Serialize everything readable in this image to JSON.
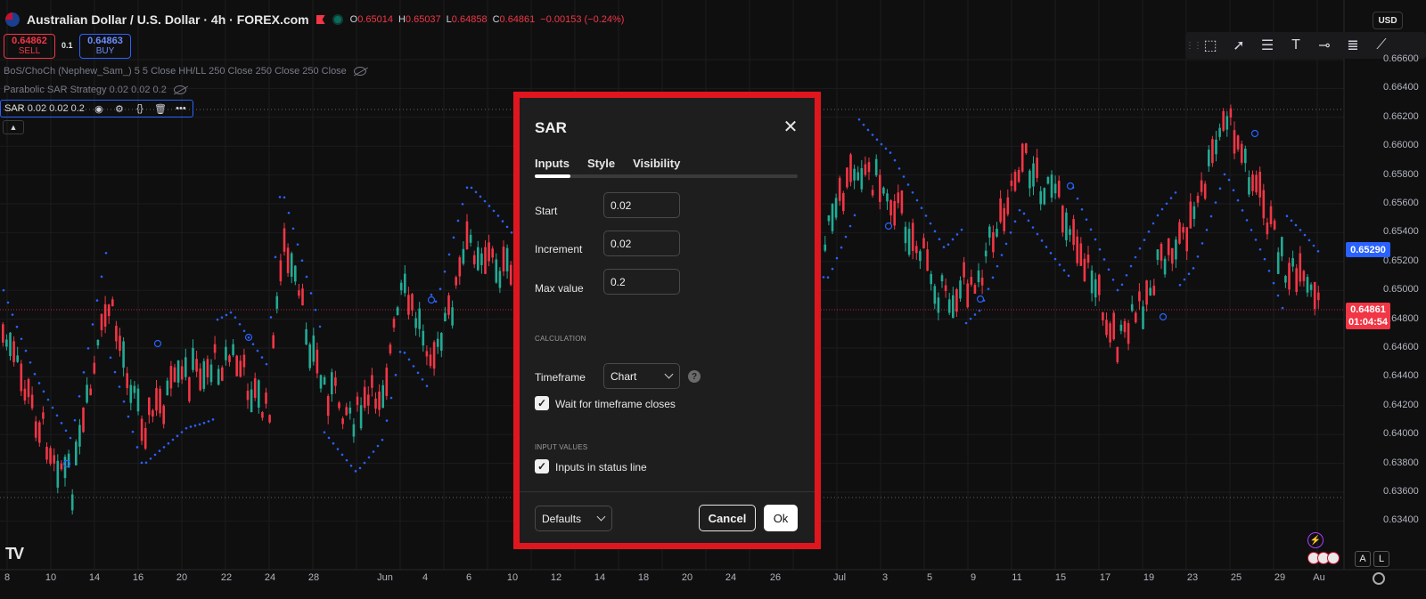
{
  "header": {
    "symbol": "Australian Dollar / U.S. Dollar · 4h · FOREX.com",
    "ohlc": [
      {
        "k": "O",
        "v": "0.65014"
      },
      {
        "k": "H",
        "v": "0.65037"
      },
      {
        "k": "L",
        "v": "0.64858"
      },
      {
        "k": "C",
        "v": "0.64861"
      },
      {
        "k": "",
        "v": "−0.00153 (−0.24%)"
      }
    ],
    "currency": "USD"
  },
  "trade": {
    "sell_price": "0.64862",
    "sell_label": "SELL",
    "spread": "0.1",
    "buy_price": "0.64863",
    "buy_label": "BUY"
  },
  "indicators": {
    "bos": "BoS/ChoCh (Nephew_Sam_) 5 5 Close HH/LL 250 Close 250 Close 250 Close",
    "psar_strategy": "Parabolic SAR Strategy 0.02 0.02 0.2",
    "sar_name": "SAR",
    "sar_params": "0.02 0.02 0.2"
  },
  "drawing_tools": [
    "cross-icon",
    "select-box-icon",
    "cursor-icon",
    "lines-icon",
    "text-icon",
    "hline-icon",
    "list-icon",
    "trend-icon"
  ],
  "price_axis": [
    "0.66600",
    "0.66400",
    "0.66200",
    "0.66000",
    "0.65800",
    "0.65600",
    "0.65400",
    "0.65200",
    "0.65000",
    "0.64800",
    "0.64600",
    "0.64400",
    "0.64200",
    "0.64000",
    "0.63800",
    "0.63600",
    "0.63400"
  ],
  "price_tags": {
    "sar_value": "0.65290",
    "last_price": "0.64861",
    "countdown": "01:04:54"
  },
  "date_axis": [
    "8",
    "10",
    "14",
    "16",
    "20",
    "22",
    "24",
    "28",
    "Jun",
    "4",
    "6",
    "10",
    "12",
    "14",
    "18",
    "20",
    "24",
    "26",
    "Jul",
    "3",
    "5",
    "9",
    "11",
    "15",
    "17",
    "19",
    "23",
    "25",
    "29",
    "Au"
  ],
  "colors": {
    "up": "#22ab94",
    "down": "#f23645",
    "sar": "#2962ff",
    "dialog_border": "#e0161f"
  },
  "dialog": {
    "title": "SAR",
    "tabs": [
      "Inputs",
      "Style",
      "Visibility"
    ],
    "active_tab": "Inputs",
    "inputs": [
      {
        "label": "Start",
        "value": "0.02"
      },
      {
        "label": "Increment",
        "value": "0.02"
      },
      {
        "label": "Max value",
        "value": "0.2"
      }
    ],
    "calc_section": "CALCULATION",
    "timeframe_label": "Timeframe",
    "timeframe_value": "Chart",
    "wait_label": "Wait for timeframe closes",
    "wait_checked": true,
    "input_values_section": "INPUT VALUES",
    "status_line_label": "Inputs in status line",
    "status_line_checked": true,
    "defaults_label": "Defaults",
    "cancel_label": "Cancel",
    "ok_label": "Ok"
  },
  "bottom": {
    "auto_label": "A",
    "log_label": "L"
  }
}
